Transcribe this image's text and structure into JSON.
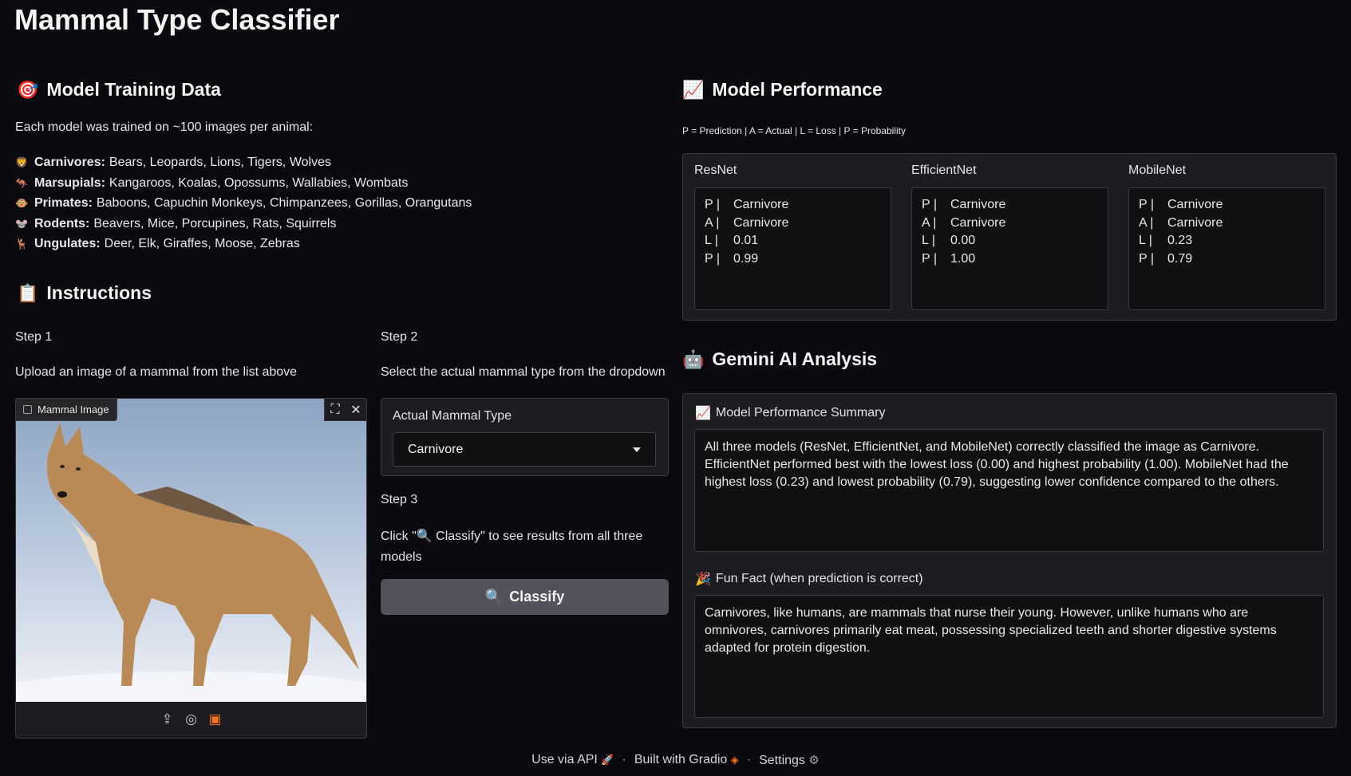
{
  "app_title": "Mammal Type Classifier",
  "training": {
    "icon": "target-icon",
    "heading": "Model Training Data",
    "intro": "Each model was trained on ~100 images per animal:",
    "items": [
      {
        "icon": "lion-icon",
        "label": "Carnivores:",
        "text": "Bears, Leopards, Lions, Tigers, Wolves"
      },
      {
        "icon": "kangaroo-icon",
        "label": "Marsupials:",
        "text": "Kangaroos, Koalas, Opossums, Wallabies, Wombats"
      },
      {
        "icon": "monkey-icon",
        "label": "Primates:",
        "text": "Baboons, Capuchin Monkeys, Chimpanzees, Gorillas, Orangutans"
      },
      {
        "icon": "mouse-icon",
        "label": "Rodents:",
        "text": "Beavers, Mice, Porcupines, Rats, Squirrels"
      },
      {
        "icon": "deer-icon",
        "label": "Ungulates:",
        "text": "Deer, Elk, Giraffes, Moose, Zebras"
      }
    ]
  },
  "instructions": {
    "icon": "clipboard-icon",
    "heading": "Instructions",
    "step1": {
      "title": "Step 1",
      "text": "Upload an image of a mammal from the list above"
    },
    "step2": {
      "title": "Step 2",
      "text": "Select the actual mammal type from the dropdown"
    },
    "step3": {
      "title": "Step 3",
      "text": "Click \"🔍 Classify\" to see results from all three models"
    }
  },
  "image_input": {
    "label": "Mammal Image",
    "fullscreen_icon": "fullscreen-icon",
    "close_icon": "close-icon",
    "tools": [
      "upload-icon",
      "webcam-icon",
      "clipboard-paste-icon"
    ]
  },
  "dropdown": {
    "label": "Actual Mammal Type",
    "value": "Carnivore"
  },
  "classify_button": {
    "icon": "magnifier-icon",
    "label": "Classify"
  },
  "performance": {
    "icon": "chart-icon",
    "heading": "Model Performance",
    "legend": "P = Prediction | A = Actual | L = Loss | P = Probability",
    "models": [
      {
        "name": "ResNet",
        "rows": [
          {
            "k": "P |",
            "v": "Carnivore"
          },
          {
            "k": "A |",
            "v": "Carnivore"
          },
          {
            "k": "L |",
            "v": "0.01"
          },
          {
            "k": "P |",
            "v": "0.99"
          }
        ]
      },
      {
        "name": "EfficientNet",
        "rows": [
          {
            "k": "P |",
            "v": "Carnivore"
          },
          {
            "k": "A |",
            "v": "Carnivore"
          },
          {
            "k": "L |",
            "v": "0.00"
          },
          {
            "k": "P |",
            "v": "1.00"
          }
        ]
      },
      {
        "name": "MobileNet",
        "rows": [
          {
            "k": "P |",
            "v": "Carnivore"
          },
          {
            "k": "A |",
            "v": "Carnivore"
          },
          {
            "k": "L |",
            "v": "0.23"
          },
          {
            "k": "P |",
            "v": "0.79"
          }
        ]
      }
    ]
  },
  "gemini": {
    "icon": "robot-icon",
    "heading": "Gemini AI Analysis",
    "summary_label": "Model Performance Summary",
    "summary_text": "All three models (ResNet, EfficientNet, and MobileNet) correctly classified the image as Carnivore. EfficientNet performed best with the lowest loss (0.00) and highest probability (1.00). MobileNet had the highest loss (0.23) and lowest probability (0.79), suggesting lower confidence compared to the others.",
    "fun_label": "Fun Fact (when prediction is correct)",
    "fun_text": "Carnivores, like humans, are mammals that nurse their young. However, unlike humans who are omnivores, carnivores primarily eat meat, possessing specialized teeth and shorter digestive systems adapted for protein digestion."
  },
  "footer": {
    "api": "Use via API",
    "built": "Built with Gradio",
    "settings": "Settings"
  }
}
